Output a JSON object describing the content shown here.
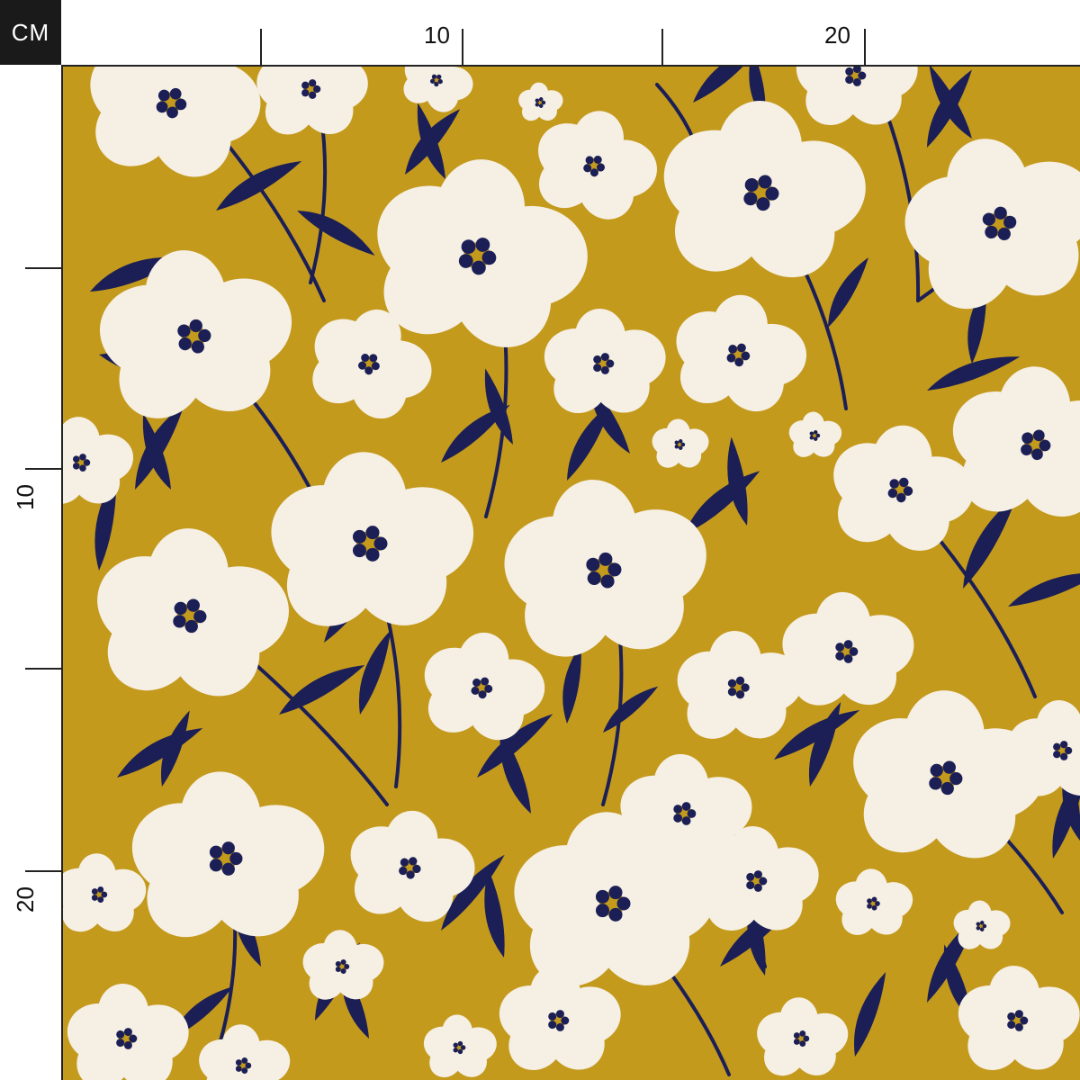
{
  "ruler": {
    "unit": "CM",
    "top_labels": [
      "10",
      "20"
    ],
    "left_labels": [
      "10",
      "20"
    ]
  },
  "colors": {
    "background": "#c49a1d",
    "petal": "#f5efe4",
    "leaf": "#1b1f56",
    "center": "#1b1f56",
    "center_accent": "#c49a1d"
  },
  "pattern": {
    "icons": [
      "flower-icon",
      "leaf-icon",
      "stem-icon"
    ]
  }
}
